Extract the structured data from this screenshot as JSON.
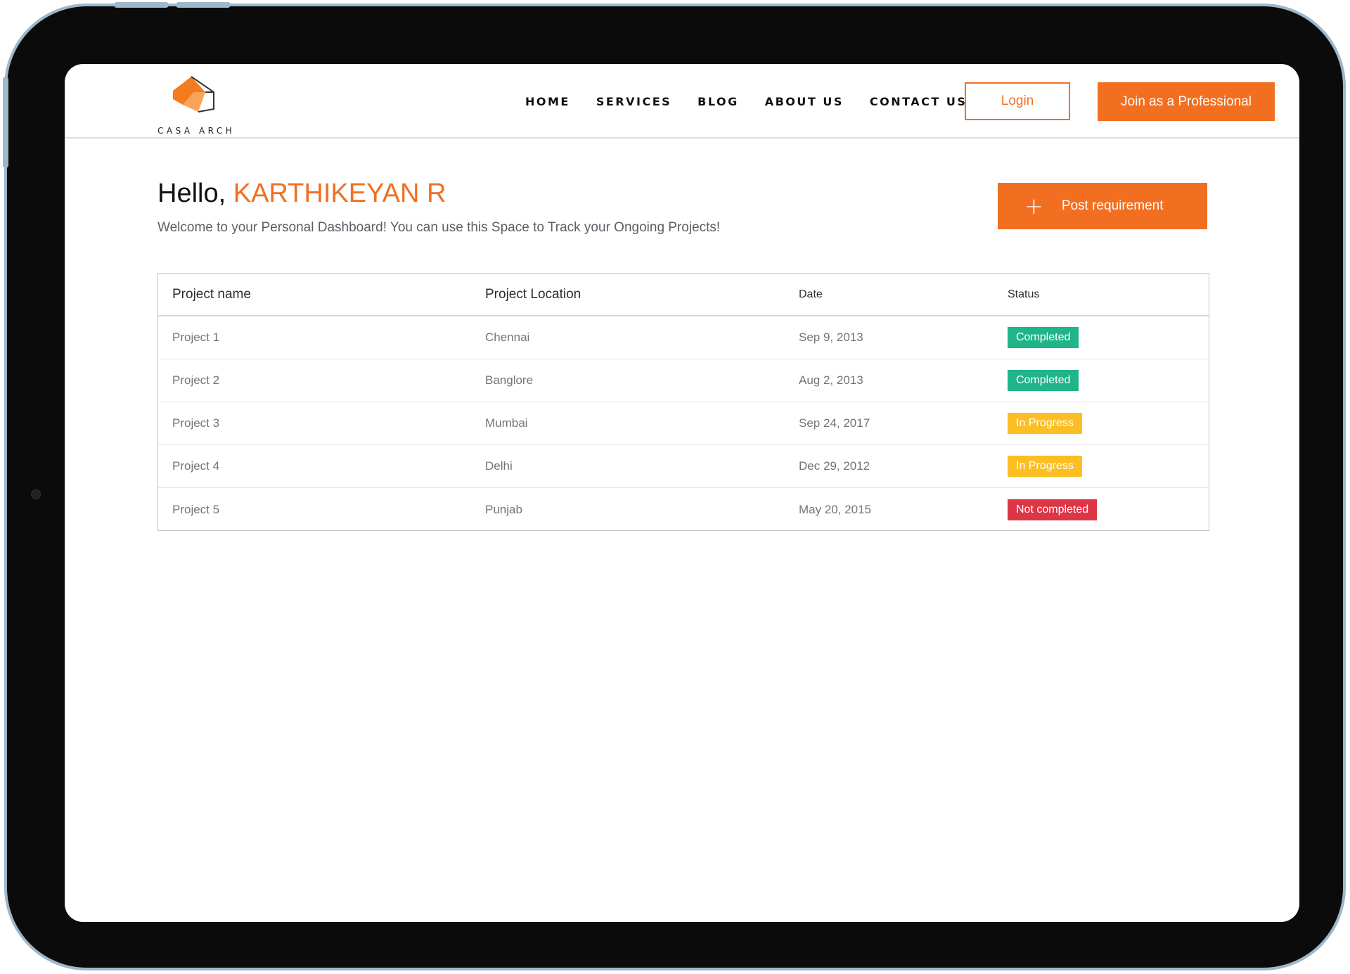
{
  "brand": {
    "name": "CASA ARCH",
    "accent": "#f26f21"
  },
  "nav": {
    "items": [
      {
        "label": "HOME"
      },
      {
        "label": "SERVICES"
      },
      {
        "label": "BLOG"
      },
      {
        "label": "ABOUT US"
      },
      {
        "label": "CONTACT US"
      }
    ],
    "login_label": "Login",
    "join_label": "Join as a Professional"
  },
  "dashboard": {
    "greeting_prefix": "Hello,",
    "user_name": "KARTHIKEYAN R",
    "welcome_text": "Welcome to your Personal Dashboard! You can use this Space to Track your Ongoing Projects!",
    "post_button_label": "Post requirement",
    "post_button_icon": "plus-icon"
  },
  "table": {
    "headers": [
      "Project name",
      "Project Location",
      "Date",
      "Status"
    ],
    "rows": [
      {
        "name": "Project 1",
        "location": "Chennai",
        "date": "Sep 9, 2013",
        "status": "Completed",
        "status_color": "#1fb489"
      },
      {
        "name": "Project 2",
        "location": "Banglore",
        "date": "Aug 2, 2013",
        "status": "Completed",
        "status_color": "#1fb489"
      },
      {
        "name": "Project 3",
        "location": "Mumbai",
        "date": "Sep 24, 2017",
        "status": "In Progress",
        "status_color": "#fbbf24"
      },
      {
        "name": "Project 4",
        "location": "Delhi",
        "date": "Dec 29, 2012",
        "status": "In Progress",
        "status_color": "#fbbf24"
      },
      {
        "name": "Project 5",
        "location": "Punjab",
        "date": "May 20, 2015",
        "status": "Not completed",
        "status_color": "#dc3545"
      }
    ]
  }
}
